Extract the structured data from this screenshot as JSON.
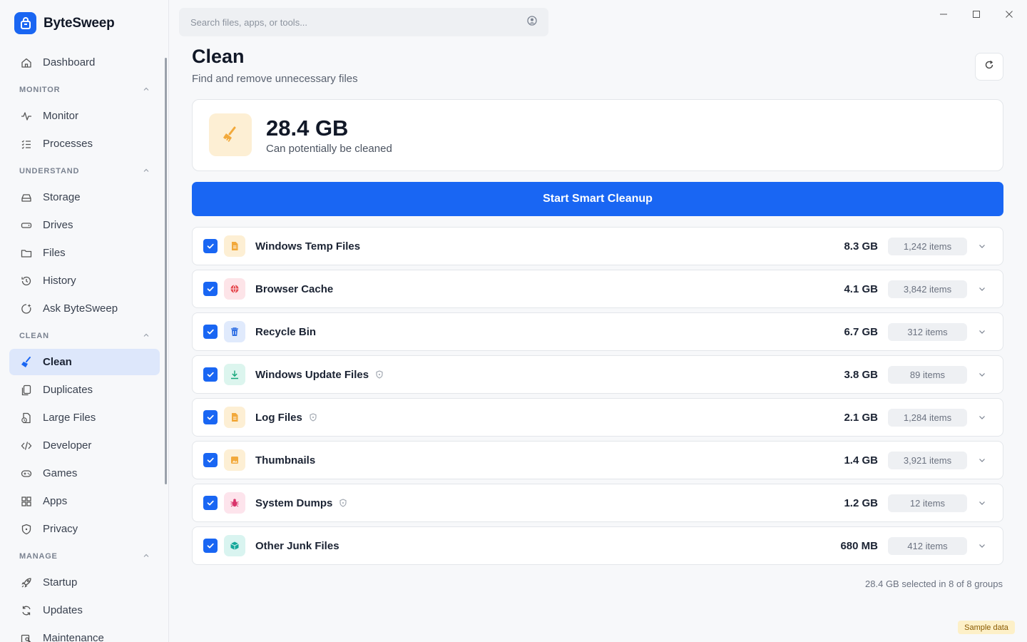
{
  "app": {
    "name": "ByteSweep"
  },
  "search": {
    "placeholder": "Search files, apps, or tools..."
  },
  "sidebar": {
    "top": [
      {
        "label": "Dashboard",
        "icon": "home-icon"
      }
    ],
    "sections": [
      {
        "title": "MONITOR",
        "items": [
          {
            "label": "Monitor",
            "icon": "pulse-icon"
          },
          {
            "label": "Processes",
            "icon": "list-icon"
          }
        ]
      },
      {
        "title": "UNDERSTAND",
        "items": [
          {
            "label": "Storage",
            "icon": "storage-icon"
          },
          {
            "label": "Drives",
            "icon": "drive-icon"
          },
          {
            "label": "Files",
            "icon": "folder-icon"
          },
          {
            "label": "History",
            "icon": "history-icon"
          },
          {
            "label": "Ask ByteSweep",
            "icon": "sparkle-icon"
          }
        ]
      },
      {
        "title": "CLEAN",
        "items": [
          {
            "label": "Clean",
            "icon": "broom-icon",
            "active": true
          },
          {
            "label": "Duplicates",
            "icon": "copy-icon"
          },
          {
            "label": "Large Files",
            "icon": "large-file-icon"
          },
          {
            "label": "Developer",
            "icon": "code-icon"
          },
          {
            "label": "Games",
            "icon": "gamepad-icon"
          },
          {
            "label": "Apps",
            "icon": "apps-icon"
          },
          {
            "label": "Privacy",
            "icon": "shield-icon"
          }
        ]
      },
      {
        "title": "MANAGE",
        "items": [
          {
            "label": "Startup",
            "icon": "rocket-icon"
          },
          {
            "label": "Updates",
            "icon": "refresh-icon"
          },
          {
            "label": "Maintenance",
            "icon": "wrench-icon"
          }
        ]
      }
    ]
  },
  "page": {
    "title": "Clean",
    "subtitle": "Find and remove unnecessary files"
  },
  "summary": {
    "size": "28.4 GB",
    "description": "Can potentially be cleaned"
  },
  "cta": {
    "label": "Start Smart Cleanup"
  },
  "groups": [
    {
      "name": "Windows Temp Files",
      "size": "8.3 GB",
      "count": "1,242 items",
      "checked": true,
      "protected": false,
      "icon": "file-icon",
      "icon_bg": "#fdefd4",
      "icon_color": "#f2a93b"
    },
    {
      "name": "Browser Cache",
      "size": "4.1 GB",
      "count": "3,842 items",
      "checked": true,
      "protected": false,
      "icon": "globe-icon",
      "icon_bg": "#fde4e8",
      "icon_color": "#e5484d"
    },
    {
      "name": "Recycle Bin",
      "size": "6.7 GB",
      "count": "312 items",
      "checked": true,
      "protected": false,
      "icon": "trash-icon",
      "icon_bg": "#e0eafc",
      "icon_color": "#2f6fe4"
    },
    {
      "name": "Windows Update Files",
      "size": "3.8 GB",
      "count": "89 items",
      "checked": true,
      "protected": true,
      "icon": "download-icon",
      "icon_bg": "#dcf5ee",
      "icon_color": "#17a67a"
    },
    {
      "name": "Log Files",
      "size": "2.1 GB",
      "count": "1,284 items",
      "checked": true,
      "protected": true,
      "icon": "file-icon",
      "icon_bg": "#fdefd4",
      "icon_color": "#f2a93b"
    },
    {
      "name": "Thumbnails",
      "size": "1.4 GB",
      "count": "3,921 items",
      "checked": true,
      "protected": false,
      "icon": "image-icon",
      "icon_bg": "#fdefd4",
      "icon_color": "#f2a93b"
    },
    {
      "name": "System Dumps",
      "size": "1.2 GB",
      "count": "12 items",
      "checked": true,
      "protected": true,
      "icon": "bug-icon",
      "icon_bg": "#fde4ec",
      "icon_color": "#d9346b"
    },
    {
      "name": "Other Junk Files",
      "size": "680 MB",
      "count": "412 items",
      "checked": true,
      "protected": false,
      "icon": "box-icon",
      "icon_bg": "#d9f4f0",
      "icon_color": "#14a89a"
    }
  ],
  "footer": {
    "selection": "28.4 GB selected in 8 of 8 groups"
  },
  "badge": {
    "label": "Sample data"
  },
  "colors": {
    "accent": "#1966f3",
    "active_nav": "#dde7fb"
  }
}
